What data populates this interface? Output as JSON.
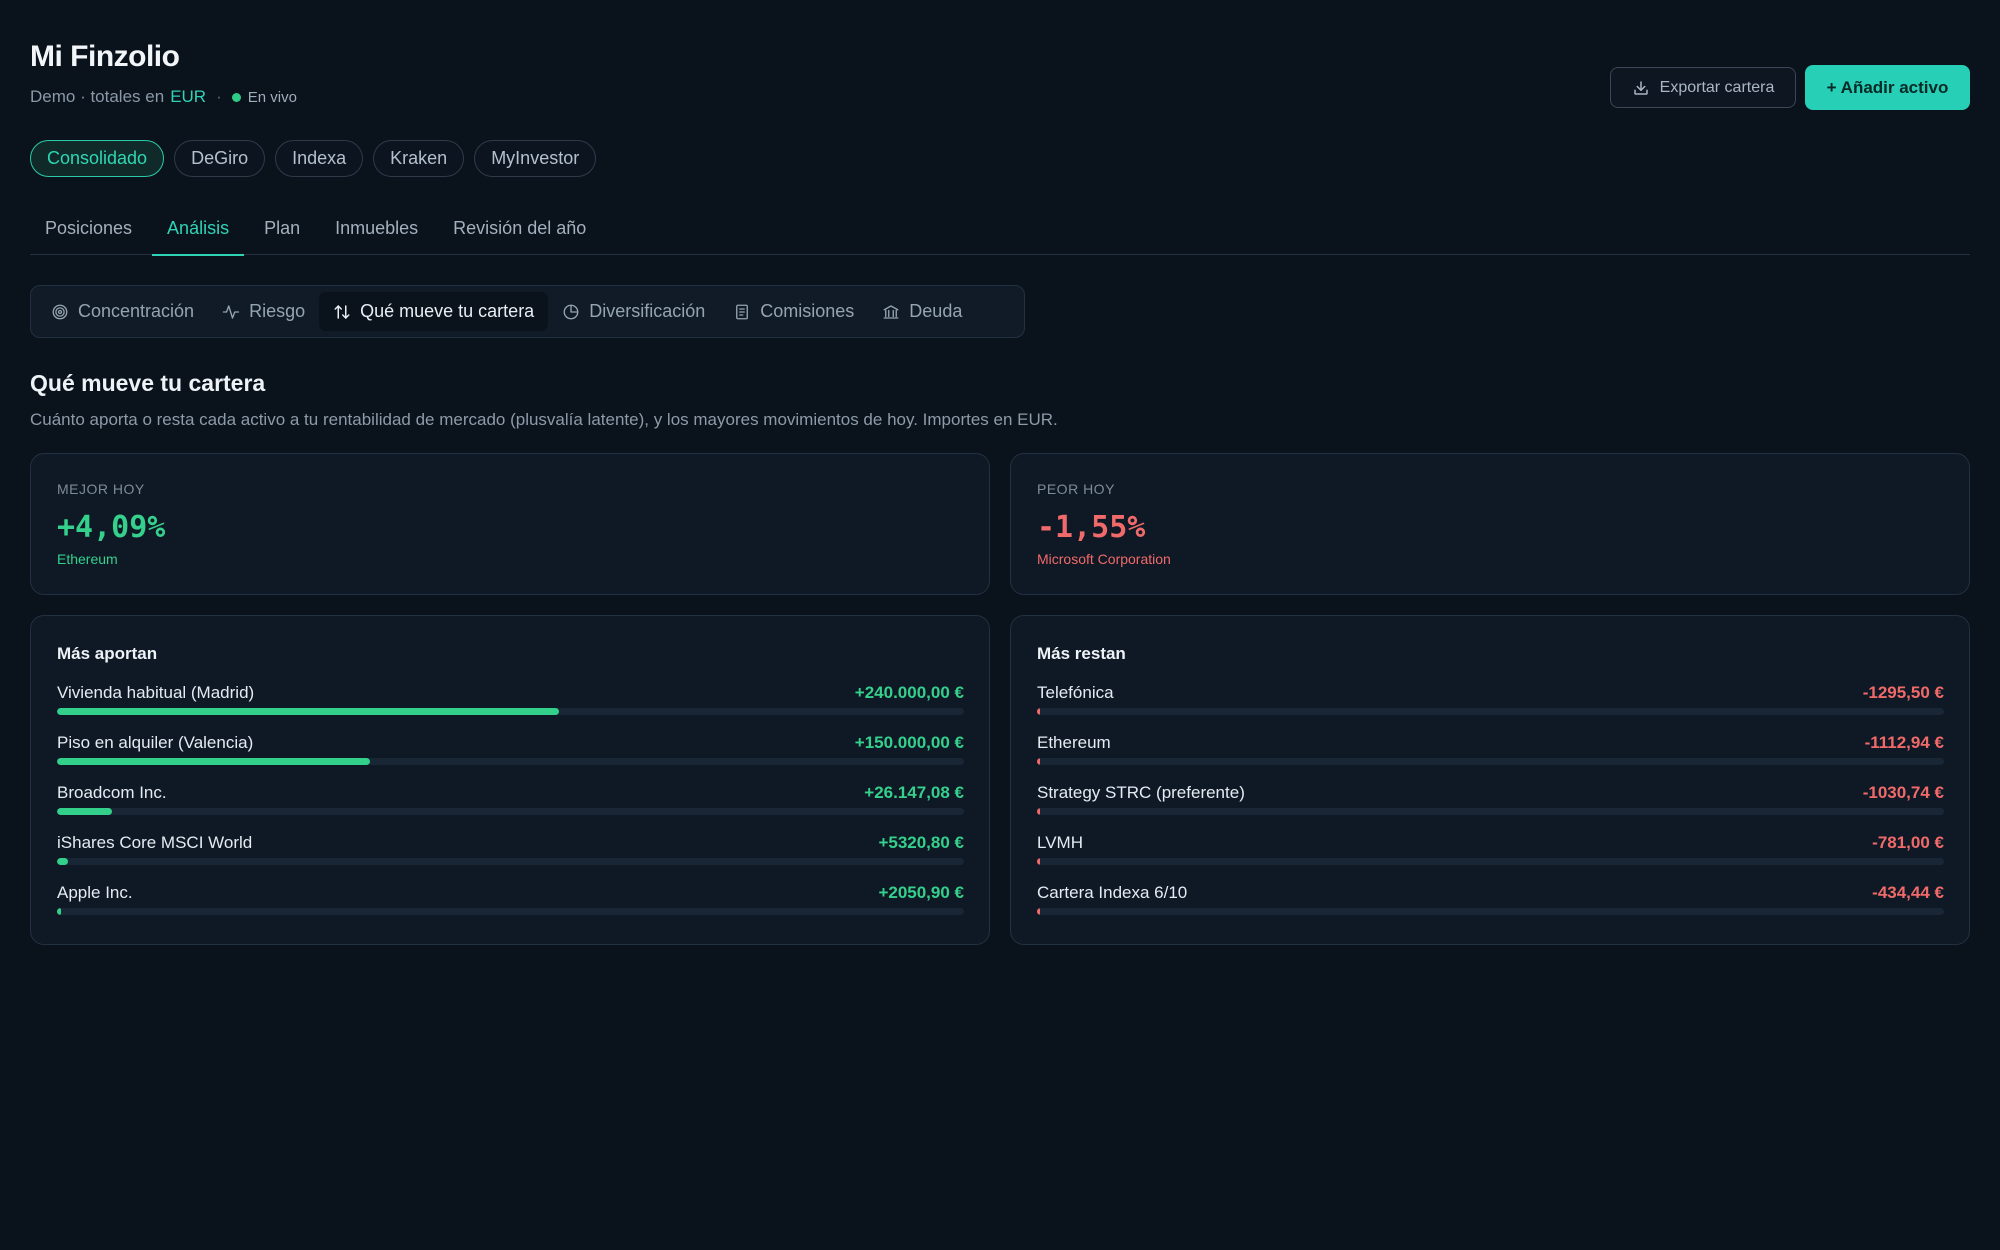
{
  "app": {
    "title": "Mi Finzolio",
    "subtitle_prefix": "Demo · totales en",
    "currency": "EUR",
    "separator": "·",
    "live_label": "En vivo",
    "live_color": "#2ecc87"
  },
  "actions": {
    "export_label": "Exportar cartera",
    "export_icon": "download-icon",
    "add_label": "+ Añadir activo",
    "accent": "#27cfb6"
  },
  "brokers": [
    {
      "label": "Consolidado",
      "active": true
    },
    {
      "label": "DeGiro",
      "active": false
    },
    {
      "label": "Indexa",
      "active": false
    },
    {
      "label": "Kraken",
      "active": false
    },
    {
      "label": "MyInvestor",
      "active": false
    }
  ],
  "tabs": [
    {
      "label": "Posiciones",
      "active": false
    },
    {
      "label": "Análisis",
      "active": true
    },
    {
      "label": "Plan",
      "active": false
    },
    {
      "label": "Inmuebles",
      "active": false
    },
    {
      "label": "Revisión del año",
      "active": false
    }
  ],
  "subtabs": [
    {
      "label": "Concentración",
      "icon": "target-icon",
      "active": false
    },
    {
      "label": "Riesgo",
      "icon": "activity-icon",
      "active": false
    },
    {
      "label": "Qué mueve tu cartera",
      "icon": "arrows-up-down-icon",
      "active": true
    },
    {
      "label": "Diversificación",
      "icon": "pie-chart-icon",
      "active": false
    },
    {
      "label": "Comisiones",
      "icon": "receipt-icon",
      "active": false
    },
    {
      "label": "Deuda",
      "icon": "bank-icon",
      "active": false
    }
  ],
  "section": {
    "title": "Qué mueve tu cartera",
    "description": "Cuánto aporta o resta cada activo a tu rentabilidad de mercado (plusvalía latente), y los mayores movimientos de hoy. Importes en EUR."
  },
  "best": {
    "label": "MEJOR HOY",
    "value": "+4,09%",
    "asset": "Ethereum",
    "color": "#34d08c"
  },
  "worst": {
    "label": "PEOR HOY",
    "value": "-1,55%",
    "asset": "Microsoft Corporation",
    "color": "#f06a6a"
  },
  "contributors": {
    "title": "Más aportan",
    "items": [
      {
        "name": "Vivienda habitual (Madrid)",
        "value": "+240.000,00 €",
        "amount": 240000.0
      },
      {
        "name": "Piso en alquiler (Valencia)",
        "value": "+150.000,00 €",
        "amount": 150000.0
      },
      {
        "name": "Broadcom Inc.",
        "value": "+26.147,08 €",
        "amount": 26147.08
      },
      {
        "name": "iShares Core MSCI World",
        "value": "+5320,80 €",
        "amount": 5320.8
      },
      {
        "name": "Apple Inc.",
        "value": "+2050,90 €",
        "amount": 2050.9
      }
    ]
  },
  "detractors": {
    "title": "Más restan",
    "items": [
      {
        "name": "Telefónica",
        "value": "-1295,50 €",
        "amount": -1295.5
      },
      {
        "name": "Ethereum",
        "value": "-1112,94 €",
        "amount": -1112.94
      },
      {
        "name": "Strategy STRC (preferente)",
        "value": "-1030,74 €",
        "amount": -1030.74
      },
      {
        "name": "LVMH",
        "value": "-781,00 €",
        "amount": -781.0
      },
      {
        "name": "Cartera Indexa 6/10",
        "value": "-434,44 €",
        "amount": -434.44
      }
    ]
  }
}
